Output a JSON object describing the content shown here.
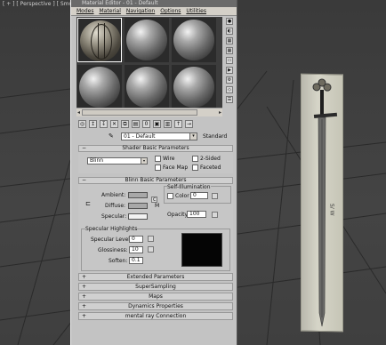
{
  "viewport": {
    "label": "[ + ] [ Perspective ] [ Smooth + "
  },
  "window": {
    "title": "Material Editor - 01 - Default"
  },
  "menu": [
    "Modes",
    "Material",
    "Navigation",
    "Options",
    "Utilities"
  ],
  "material": {
    "name": "01 - Default",
    "type": "Standard"
  },
  "shader_basic": {
    "title": "Shader Basic Parameters",
    "shader": "Blinn",
    "wire": "Wire",
    "two_sided": "2-Sided",
    "face_map": "Face Map",
    "faceted": "Faceted"
  },
  "blinn_basic": {
    "title": "Blinn Basic Parameters",
    "ambient": "Ambient:",
    "diffuse": "Diffuse:",
    "specular": "Specular:",
    "self_illum": "Self-Illumination",
    "color": "Color",
    "self_illum_value": "0",
    "opacity_label": "Opacity:",
    "opacity_value": "100",
    "lock_c": "C",
    "map_m": "M",
    "colors": {
      "ambient": "#a8a8a8",
      "diffuse": "#a8a8a8",
      "specular": "#f2f2f2"
    }
  },
  "specular_highlights": {
    "title": "Specular Highlights",
    "level_label": "Specular Level:",
    "level_value": "0",
    "gloss_label": "Glossiness:",
    "gloss_value": "10",
    "soften_label": "Soften:",
    "soften_value": "0.1"
  },
  "rollouts": [
    "Extended Parameters",
    "SuperSampling",
    "Maps",
    "Dynamics Properties",
    "mental ray Connection"
  ],
  "sword_text": "S/ W"
}
